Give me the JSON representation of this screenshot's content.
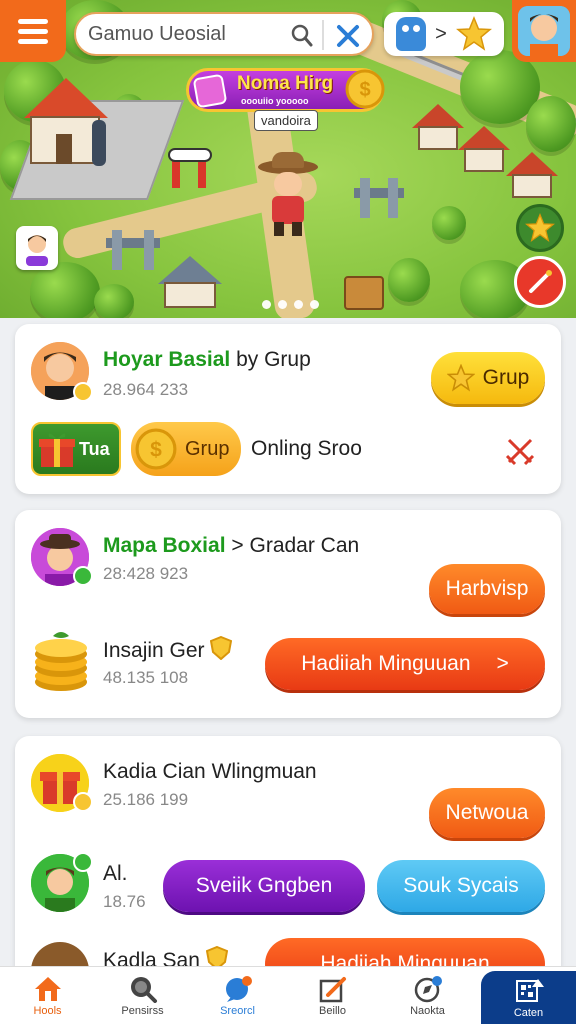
{
  "top_bar": {
    "search_placeholder": "Gamuo Uеosial",
    "pill_chevron": ">"
  },
  "map": {
    "banner_title": "Noma Hirg",
    "banner_sub": "ooouiio yooooo",
    "tag_label": "vandoira",
    "page_dots": 4
  },
  "cards": {
    "card1": {
      "name_green": "Hoyar Basial",
      "name_rest": "by Grup",
      "number": "28.964 233",
      "button": "Grup",
      "chip1_label": "Tua",
      "chip2_label": "Grup",
      "text": "Onling Sroo"
    },
    "card2": {
      "name_green": "Mapa Boxial",
      "name_rest": "> Gradar Can",
      "number": "28:428 923",
      "button1": "Harbvisp",
      "item_name": "Insajin Ger",
      "item_number": "48.135 108",
      "button2": "Hadiiah Minguuan",
      "button2_chevron": ">"
    },
    "card3": {
      "name": "Kadia Cian Wlingmuan",
      "number": "25.186 199",
      "button1": "Netwoua",
      "row2_name": "Al.",
      "row2_number": "18.76",
      "purple_button": "Sveiik Gngben",
      "blue_button": "Souk Sycais",
      "row3_name": "Kadla San",
      "row3_button": "Hadiiah Minguuan"
    }
  },
  "bottom_nav": [
    {
      "label": "Hools",
      "icon": "home-icon"
    },
    {
      "label": "Pensirss",
      "icon": "search-icon"
    },
    {
      "label": "Sreorcl",
      "icon": "chat-icon"
    },
    {
      "label": "Beillo",
      "icon": "edit-icon"
    },
    {
      "label": "Naokta",
      "icon": "compass-icon"
    },
    {
      "label": "Caten",
      "icon": "qr-icon"
    }
  ],
  "colors": {
    "accent_orange": "#f26a1b",
    "green_name": "#1d9a1d",
    "scan_blue": "#0c3d8a"
  }
}
